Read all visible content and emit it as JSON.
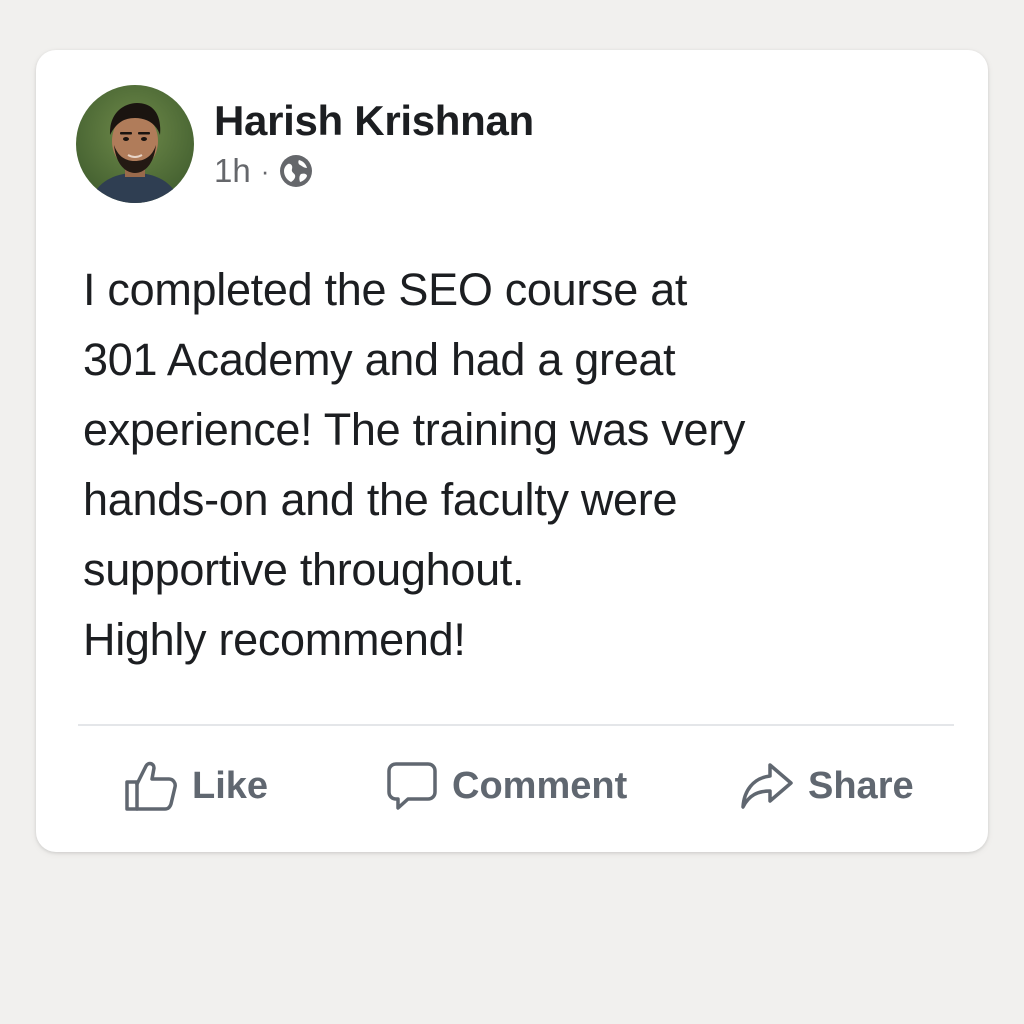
{
  "post": {
    "author": {
      "name": "Harish Krishnan",
      "avatar_icon": "profile-photo"
    },
    "meta": {
      "timestamp": "1h",
      "separator": "·",
      "audience_icon": "globe-icon"
    },
    "body_lines": [
      "I completed the SEO course at",
      "301 Academy and had a great",
      "experience! The training was very",
      "hands-on and the faculty were",
      "supportive throughout.",
      "Highly recommend!"
    ],
    "actions": {
      "like": {
        "label": "Like",
        "icon": "thumbs-up-icon"
      },
      "comment": {
        "label": "Comment",
        "icon": "speech-bubble-icon"
      },
      "share": {
        "label": "Share",
        "icon": "share-arrow-icon"
      }
    }
  },
  "colors": {
    "page_background": "#f1f0ee",
    "card_background": "#ffffff",
    "text_primary": "#1c1e21",
    "text_secondary": "#65676b",
    "action_text": "#606770",
    "divider": "#e4e6e9"
  }
}
